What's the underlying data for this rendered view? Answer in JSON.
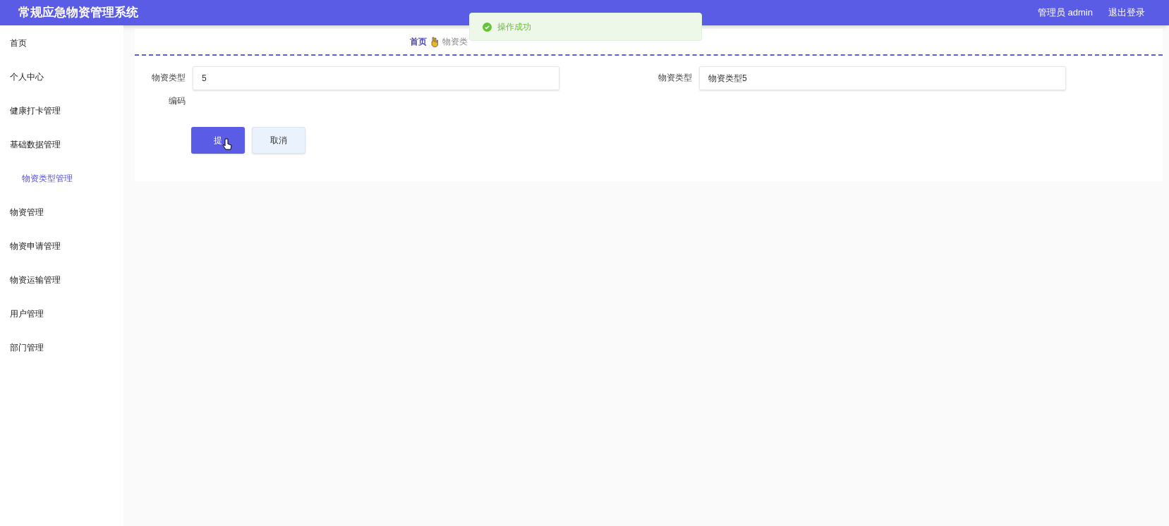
{
  "header": {
    "title": "常规应急物资管理系统",
    "user": "管理员 admin",
    "logout": "退出登录"
  },
  "sidebar": {
    "items": [
      {
        "label": "首页",
        "selected": false
      },
      {
        "label": "个人中心",
        "selected": false
      },
      {
        "label": "健康打卡管理",
        "selected": false
      },
      {
        "label": "基础数据管理",
        "selected": false,
        "expanded": true,
        "children": [
          {
            "label": "物资类型管理",
            "selected": true
          }
        ]
      },
      {
        "label": "物资管理",
        "selected": false
      },
      {
        "label": "物资申请管理",
        "selected": false
      },
      {
        "label": "物资运输管理",
        "selected": false
      },
      {
        "label": "用户管理",
        "selected": false
      },
      {
        "label": "部门管理",
        "selected": false
      }
    ]
  },
  "breadcrumb": [
    "首页",
    "物资类"
  ],
  "form": {
    "fields": [
      {
        "label": "物资类型编码",
        "value": "5"
      },
      {
        "label": "物资类型",
        "value": "物资类型5"
      }
    ],
    "buttons": [
      {
        "label": "提",
        "kind": "primary"
      },
      {
        "label": "取消",
        "kind": "secondary"
      }
    ]
  },
  "toast": {
    "message": "操作成功"
  }
}
